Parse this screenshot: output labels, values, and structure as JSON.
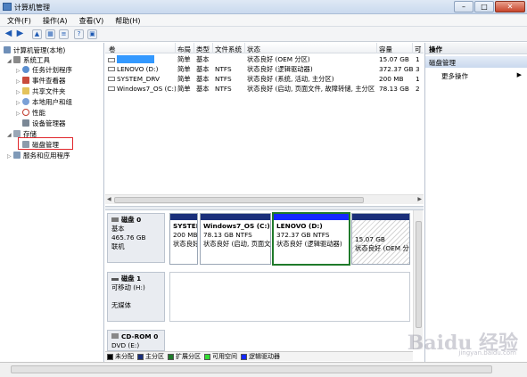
{
  "window": {
    "title": "计算机管理",
    "buttons": {
      "minimize": "–",
      "maximize": "□",
      "close": "✕"
    }
  },
  "menu": [
    "文件(F)",
    "操作(A)",
    "查看(V)",
    "帮助(H)"
  ],
  "toolbar": [
    "back",
    "forward",
    "up",
    "properties",
    "help",
    "console",
    "refresh"
  ],
  "tree": {
    "root": "计算机管理(本地)",
    "system_tools": "系统工具",
    "task_scheduler": "任务计划程序",
    "event_viewer": "事件查看器",
    "shared_folders": "共享文件夹",
    "local_users": "本地用户和组",
    "performance": "性能",
    "device_manager": "设备管理器",
    "storage": "存储",
    "disk_management": "磁盘管理",
    "services": "服务和应用程序"
  },
  "list": {
    "headers": [
      "卷",
      "布局",
      "类型",
      "文件系统",
      "状态",
      "容量",
      "可"
    ],
    "rows": [
      {
        "vol": "",
        "layout": "简单",
        "type": "基本",
        "fs": "",
        "status": "状态良好 (OEM 分区)",
        "cap": "15.07 GB",
        "free": "1"
      },
      {
        "vol": "LENOVO (D:)",
        "layout": "简单",
        "type": "基本",
        "fs": "NTFS",
        "status": "状态良好 (逻辑驱动器)",
        "cap": "372.37 GB",
        "free": "3"
      },
      {
        "vol": "SYSTEM_DRV",
        "layout": "简单",
        "type": "基本",
        "fs": "NTFS",
        "status": "状态良好 (系统, 活动, 主分区)",
        "cap": "200 MB",
        "free": "1"
      },
      {
        "vol": "Windows7_OS (C:)",
        "layout": "简单",
        "type": "基本",
        "fs": "NTFS",
        "status": "状态良好 (启动, 页面文件, 故障转储, 主分区)",
        "cap": "78.13 GB",
        "free": "2"
      }
    ]
  },
  "disks": {
    "disk0": {
      "name": "磁盘 0",
      "type": "基本",
      "size": "465.76 GB",
      "state": "联机"
    },
    "disk1": {
      "name": "磁盘 1",
      "type": "可移动 (H:)",
      "state": "无媒体"
    },
    "cdrom": {
      "name": "CD-ROM 0",
      "type": "DVD (E:)"
    }
  },
  "partitions": [
    {
      "name": "SYSTEM",
      "size": "200 MB",
      "status": "状态良好"
    },
    {
      "name": "Windows7_OS (C:)",
      "size": "78.13 GB NTFS",
      "status": "状态良好 (启动, 页面文"
    },
    {
      "name": "LENOVO (D:)",
      "size": "372.37 GB NTFS",
      "status": "状态良好 (逻辑驱动器)"
    },
    {
      "name": "",
      "size": "15.07 GB",
      "status": "状态良好 (OEM 分"
    }
  ],
  "legend": [
    {
      "label": "未分配",
      "color": "#000000"
    },
    {
      "label": "主分区",
      "color": "#1a2f7a"
    },
    {
      "label": "扩展分区",
      "color": "#1f7a2a"
    },
    {
      "label": "可用空间",
      "color": "#33dd33"
    },
    {
      "label": "逻辑驱动器",
      "color": "#1428ff"
    }
  ],
  "actions": {
    "header": "操作",
    "section": "磁盘管理",
    "more": "更多操作"
  },
  "watermark": {
    "text": "Baidu 经验",
    "sub": "jingyan.baidu.com"
  }
}
